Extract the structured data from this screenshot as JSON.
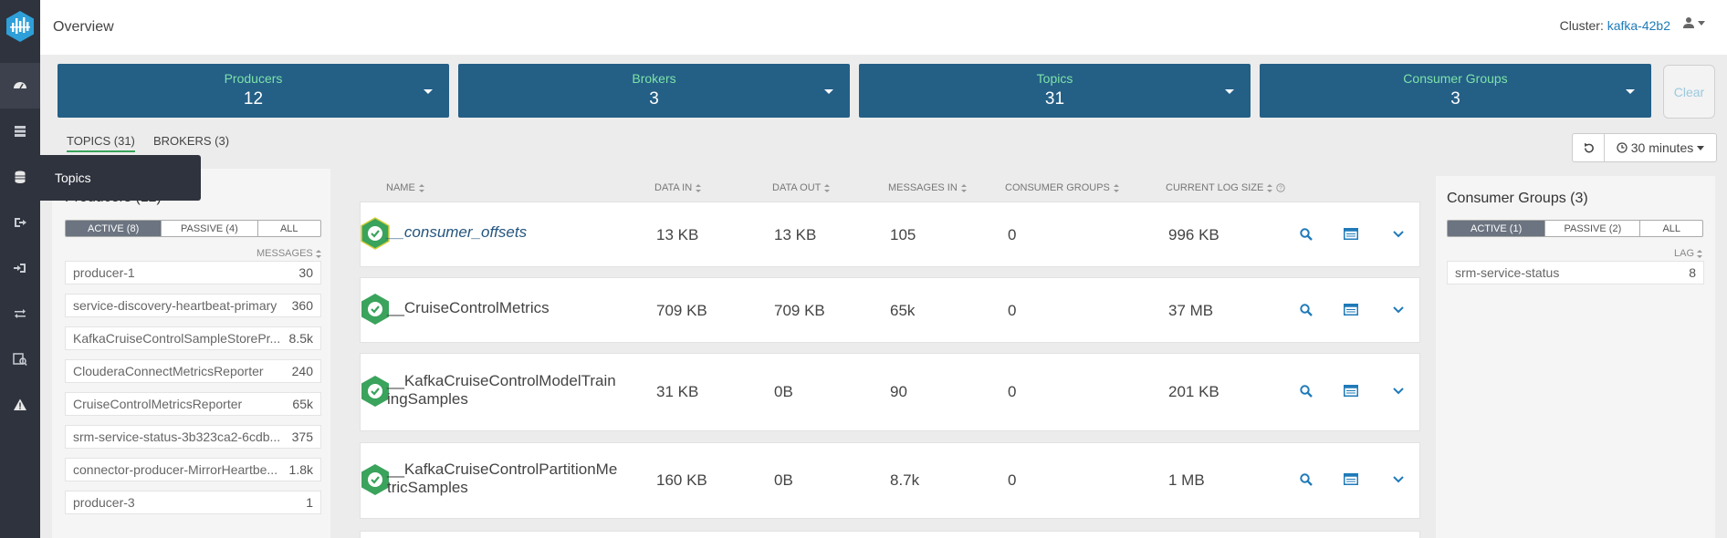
{
  "header": {
    "title": "Overview",
    "cluster_label": "Cluster:",
    "cluster_name": "kafka-42b2"
  },
  "tooltip": {
    "text": "Topics"
  },
  "cards": [
    {
      "label": "Producers",
      "value": "12"
    },
    {
      "label": "Brokers",
      "value": "3"
    },
    {
      "label": "Topics",
      "value": "31"
    },
    {
      "label": "Consumer Groups",
      "value": "3"
    }
  ],
  "clear_label": "Clear",
  "tabs": [
    {
      "label": "TOPICS (31)"
    },
    {
      "label": "BROKERS (3)"
    }
  ],
  "time_range": "30 minutes",
  "producers": {
    "title": "Producers (12)",
    "filters": [
      "ACTIVE (8)",
      "PASSIVE (4)",
      "ALL"
    ],
    "column": "MESSAGES",
    "items": [
      {
        "name": "producer-1",
        "count": "30"
      },
      {
        "name": "service-discovery-heartbeat-primary",
        "count": "360"
      },
      {
        "name": "KafkaCruiseControlSampleStorePr...",
        "count": "8.5k"
      },
      {
        "name": "ClouderaConnectMetricsReporter",
        "count": "240"
      },
      {
        "name": "CruiseControlMetricsReporter",
        "count": "65k"
      },
      {
        "name": "srm-service-status-3b323ca2-6cdb...",
        "count": "375"
      },
      {
        "name": "connector-producer-MirrorHeartbe...",
        "count": "1.8k"
      },
      {
        "name": "producer-3",
        "count": "1"
      }
    ]
  },
  "topics_table": {
    "columns": [
      "NAME",
      "DATA IN",
      "DATA OUT",
      "MESSAGES IN",
      "CONSUMER GROUPS",
      "CURRENT LOG SIZE"
    ],
    "rows": [
      {
        "name": "__consumer_offsets",
        "data_in": "13 KB",
        "data_out": "13 KB",
        "messages_in": "105",
        "consumer_groups": "0",
        "log_size": "996 KB"
      },
      {
        "name": "__CruiseControlMetrics",
        "data_in": "709 KB",
        "data_out": "709 KB",
        "messages_in": "65k",
        "consumer_groups": "0",
        "log_size": "37 MB"
      },
      {
        "name_line1": "__KafkaCruiseControlModelTrain",
        "name_line2": "ingSamples",
        "data_in": "31 KB",
        "data_out": "0B",
        "messages_in": "90",
        "consumer_groups": "0",
        "log_size": "201 KB"
      },
      {
        "name_line1": "__KafkaCruiseControlPartitionMe",
        "name_line2": "tricSamples",
        "data_in": "160 KB",
        "data_out": "0B",
        "messages_in": "8.7k",
        "consumer_groups": "0",
        "log_size": "1 MB"
      }
    ]
  },
  "consumer_groups": {
    "title": "Consumer Groups (3)",
    "filters": [
      "ACTIVE (1)",
      "PASSIVE (2)",
      "ALL"
    ],
    "column": "LAG",
    "items": [
      {
        "name": "srm-service-status",
        "count": "8"
      }
    ]
  },
  "colors": {
    "card_bg": "#245f86",
    "card_label": "#7de3a8",
    "nav_bg": "#2f333e",
    "status_green": "#3aa35c",
    "link_blue": "#1f7ab8"
  }
}
